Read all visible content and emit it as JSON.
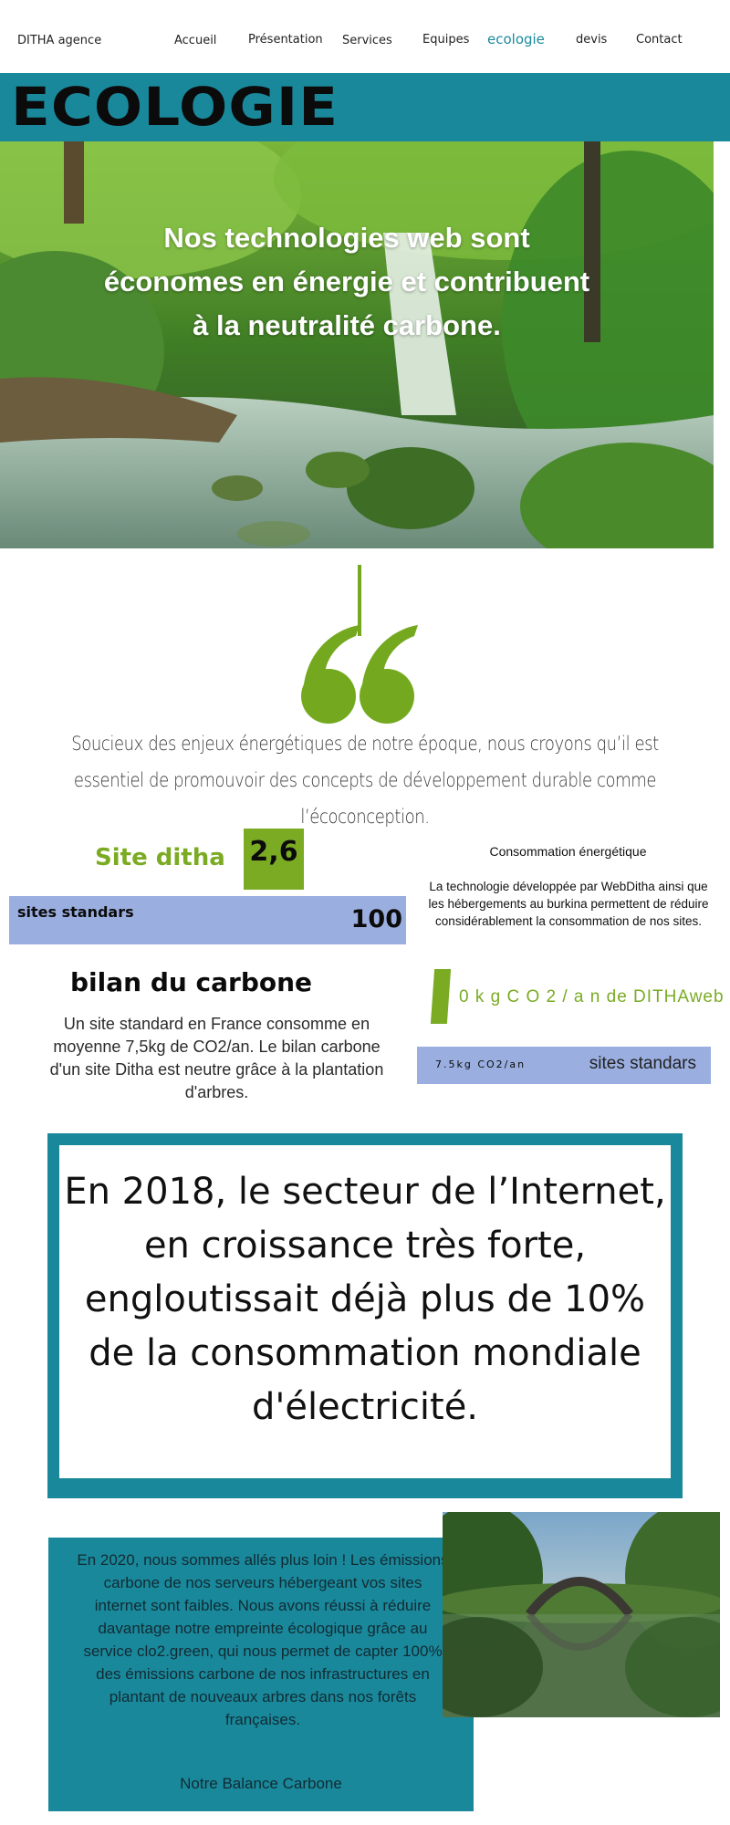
{
  "nav": {
    "brand": "DITHA agence",
    "items": [
      {
        "label": "Accueil"
      },
      {
        "label": "Présentation"
      },
      {
        "label": "Services"
      },
      {
        "label": "Equipes"
      },
      {
        "label": "ecologie",
        "active": true
      },
      {
        "label": "devis"
      },
      {
        "label": "Contact"
      }
    ]
  },
  "banner": {
    "title": "ECOLOGIE",
    "color": "#1a889b"
  },
  "hero": {
    "text": "Nos technologies web sont économes en énergie et contribuent à la neutralité carbone."
  },
  "quote": {
    "text": "Soucieux des enjeux énergétiques de notre époque, nous croyons qu’il est essentiel de promouvoir des concepts de développement durable comme l’écoconception.",
    "accent": "#74a91f"
  },
  "stats": {
    "site_ditha_label": "Site ditha",
    "site_ditha_value": "2,6",
    "standard_label": "sites standars",
    "standard_value": "100",
    "bilan_title": "bilan du carbone",
    "bilan_text": "Un site standard en France consomme en moyenne 7,5kg de CO2/an. Le bilan carbone d'un site Ditha est neutre grâce à la plantation d'arbres.",
    "conso_title": "Consommation énergétique",
    "conso_text": "La technologie développée par WebDitha ainsi que les hébergements au burkina  permettent de réduire considérablement la consommation de nos sites.",
    "dithaweb_stat": "0 k g   C O 2 / a n de DITHAweb",
    "std_co2": "7.5kg CO2/an",
    "std_label2": "sites standars"
  },
  "big_quote": {
    "text": "En 2018, le secteur de l’Internet, en croissance très forte, engloutissait déjà plus de 10% de la consommation mondiale d'électricité."
  },
  "section_2020": {
    "text": "En 2020, nous sommes allés plus loin ! Les émissions carbone de nos serveurs hébergeant vos sites internet sont faibles. Nous avons réussi à réduire davantage notre empreinte écologique grâce au service clo2.green, qui nous permet de capter 100% des émissions carbone de nos infrastructures en plantant de nouveaux arbres dans nos forêts françaises.",
    "link_label": "Notre Balance Carbone"
  }
}
